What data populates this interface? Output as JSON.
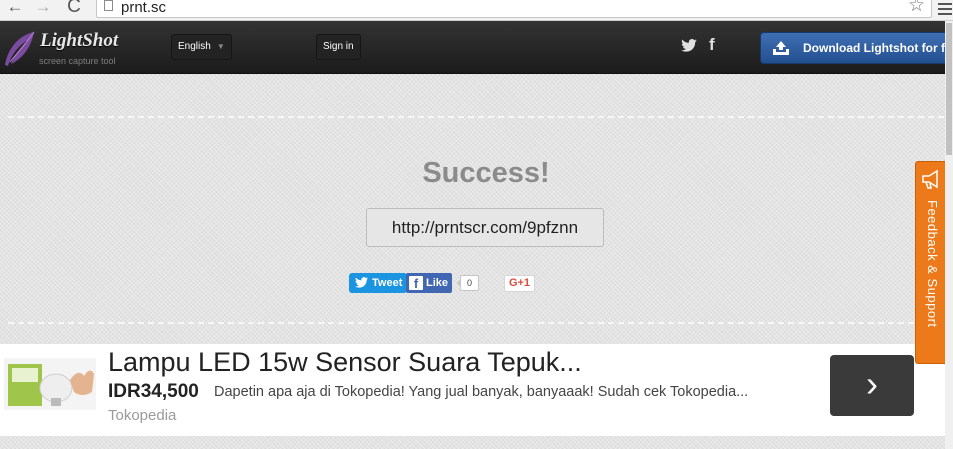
{
  "browser": {
    "url": "prnt.sc",
    "back_icon": "←",
    "forward_icon": "→",
    "reload_icon": "C",
    "star_icon": "☆"
  },
  "header": {
    "logo_title": "LightShot",
    "logo_subtitle": "screen capture tool",
    "language": "English",
    "sign_in": "Sign in",
    "download_label": "Download Lightshot for free",
    "facebook_icon": "f"
  },
  "main": {
    "success_text": "Success!",
    "share_link": "http://prntscr.com/9pfznn",
    "tweet_label": "Tweet",
    "like_label": "Like",
    "like_count": "0",
    "gplus_label": "G+1"
  },
  "ad": {
    "title": "Lampu LED 15w Sensor Suara Tepuk...",
    "price": "IDR34,500",
    "description": "Dapetin apa aja di Tokopedia! Yang jual banyak, banyaaak! Sudah cek Tokopedia...",
    "source": "Tokopedia",
    "arrow": "›"
  },
  "feedback": {
    "label": "Feedback & Support"
  },
  "colors": {
    "header_bg": "#222222",
    "download_blue": "#2e5fa3",
    "feedback_orange": "#ed7a1a",
    "tweet_blue": "#1b95e0",
    "facebook_blue": "#4267b2",
    "success_gray": "#8b8b8b"
  }
}
